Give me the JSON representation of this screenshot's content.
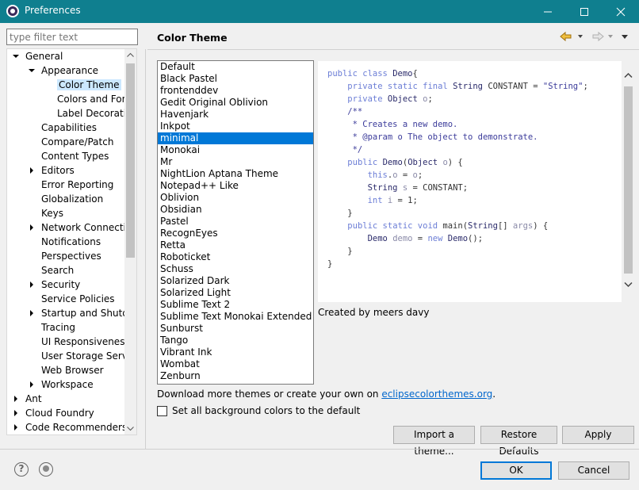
{
  "window": {
    "title": "Preferences"
  },
  "filter": {
    "placeholder": "type filter text"
  },
  "tree": {
    "items": [
      {
        "label": "General",
        "level": 0,
        "expander": "expanded"
      },
      {
        "label": "Appearance",
        "level": 1,
        "expander": "expanded"
      },
      {
        "label": "Color Theme",
        "level": 2,
        "expander": "none",
        "selected": true
      },
      {
        "label": "Colors and Fonts",
        "level": 2,
        "expander": "none"
      },
      {
        "label": "Label Decorations",
        "level": 2,
        "expander": "none"
      },
      {
        "label": "Capabilities",
        "level": 1,
        "expander": "none"
      },
      {
        "label": "Compare/Patch",
        "level": 1,
        "expander": "none"
      },
      {
        "label": "Content Types",
        "level": 1,
        "expander": "none"
      },
      {
        "label": "Editors",
        "level": 1,
        "expander": "collapsed"
      },
      {
        "label": "Error Reporting",
        "level": 1,
        "expander": "none"
      },
      {
        "label": "Globalization",
        "level": 1,
        "expander": "none"
      },
      {
        "label": "Keys",
        "level": 1,
        "expander": "none"
      },
      {
        "label": "Network Connections",
        "level": 1,
        "expander": "collapsed"
      },
      {
        "label": "Notifications",
        "level": 1,
        "expander": "none"
      },
      {
        "label": "Perspectives",
        "level": 1,
        "expander": "none"
      },
      {
        "label": "Search",
        "level": 1,
        "expander": "none"
      },
      {
        "label": "Security",
        "level": 1,
        "expander": "collapsed"
      },
      {
        "label": "Service Policies",
        "level": 1,
        "expander": "none"
      },
      {
        "label": "Startup and Shutdown",
        "level": 1,
        "expander": "collapsed"
      },
      {
        "label": "Tracing",
        "level": 1,
        "expander": "none"
      },
      {
        "label": "UI Responsiveness Monitoring",
        "level": 1,
        "expander": "none"
      },
      {
        "label": "User Storage Service",
        "level": 1,
        "expander": "none"
      },
      {
        "label": "Web Browser",
        "level": 1,
        "expander": "none"
      },
      {
        "label": "Workspace",
        "level": 1,
        "expander": "collapsed"
      },
      {
        "label": "Ant",
        "level": 0,
        "expander": "collapsed"
      },
      {
        "label": "Cloud Foundry",
        "level": 0,
        "expander": "collapsed"
      },
      {
        "label": "Code Recommenders",
        "level": 0,
        "expander": "collapsed"
      }
    ]
  },
  "page": {
    "title": "Color Theme"
  },
  "themes": {
    "selected": "minimal",
    "items": [
      "Default",
      "Black Pastel",
      "frontenddev",
      "Gedit Original Oblivion",
      "Havenjark",
      "Inkpot",
      "minimal",
      "Monokai",
      "Mr",
      "NightLion Aptana Theme",
      "Notepad++ Like",
      "Oblivion",
      "Obsidian",
      "Pastel",
      "RecognEyes",
      "Retta",
      "Roboticket",
      "Schuss",
      "Solarized Dark",
      "Solarized Light",
      "Sublime Text 2",
      "Sublime Text Monokai Extended",
      "Sunburst",
      "Tango",
      "Vibrant Ink",
      "Wombat",
      "Zenburn"
    ]
  },
  "preview": {
    "lines": [
      [
        [
          "kw",
          "public class "
        ],
        [
          "cls",
          "Demo"
        ],
        [
          "",
          "{"
        ]
      ],
      [
        [
          "",
          "    "
        ],
        [
          "kw",
          "private static final "
        ],
        [
          "cls",
          "String "
        ],
        [
          "",
          "CONSTANT = "
        ],
        [
          "str",
          "\"String\""
        ],
        [
          "",
          ";"
        ]
      ],
      [
        [
          "",
          "    "
        ],
        [
          "kw",
          "private "
        ],
        [
          "cls",
          "Object "
        ],
        [
          "var",
          "o"
        ],
        [
          "",
          ";"
        ]
      ],
      [
        [
          "",
          ""
        ]
      ],
      [
        [
          "cm",
          "    /**"
        ]
      ],
      [
        [
          "cm",
          "     * Creates a new demo."
        ]
      ],
      [
        [
          "cm",
          "     * @param o The object to demonstrate."
        ]
      ],
      [
        [
          "cm",
          "     */"
        ]
      ],
      [
        [
          "",
          "    "
        ],
        [
          "kw",
          "public "
        ],
        [
          "cls",
          "Demo"
        ],
        [
          "",
          "("
        ],
        [
          "cls",
          "Object "
        ],
        [
          "var",
          "o"
        ],
        [
          "",
          ") {"
        ]
      ],
      [
        [
          "",
          "        "
        ],
        [
          "kw",
          "this"
        ],
        [
          "",
          "."
        ],
        [
          "var",
          "o"
        ],
        [
          "",
          " = "
        ],
        [
          "var",
          "o"
        ],
        [
          "",
          ";"
        ]
      ],
      [
        [
          "",
          "        "
        ],
        [
          "cls",
          "String "
        ],
        [
          "var",
          "s"
        ],
        [
          "",
          " = CONSTANT;"
        ]
      ],
      [
        [
          "",
          "        "
        ],
        [
          "kw",
          "int "
        ],
        [
          "var",
          "i"
        ],
        [
          "",
          " = 1;"
        ]
      ],
      [
        [
          "",
          "    }"
        ]
      ],
      [
        [
          "",
          ""
        ]
      ],
      [
        [
          "",
          "    "
        ],
        [
          "kw",
          "public static void "
        ],
        [
          "",
          "main("
        ],
        [
          "cls",
          "String"
        ],
        [
          "",
          "[] "
        ],
        [
          "var",
          "args"
        ],
        [
          "",
          ") {"
        ]
      ],
      [
        [
          "",
          "        "
        ],
        [
          "cls",
          "Demo "
        ],
        [
          "var",
          "demo"
        ],
        [
          "",
          " = "
        ],
        [
          "kw",
          "new "
        ],
        [
          "cls",
          "Demo"
        ],
        [
          "",
          "();"
        ]
      ],
      [
        [
          "",
          "    }"
        ]
      ],
      [
        [
          "",
          "}"
        ]
      ]
    ]
  },
  "credit": "Created by meers davy",
  "download": {
    "text": "Download more themes or create your own on ",
    "link": "eclipsecolorthemes.org",
    "suffix": "."
  },
  "checkbox": {
    "label": "Set all background colors to the default",
    "checked": false
  },
  "buttons": {
    "import": "Import a theme...",
    "restore": "Restore Defaults",
    "apply": "Apply",
    "ok": "OK",
    "cancel": "Cancel"
  },
  "colors": {
    "titlebar": "#0f7f8f",
    "selection": "#0078d7",
    "link": "#0066cc"
  }
}
